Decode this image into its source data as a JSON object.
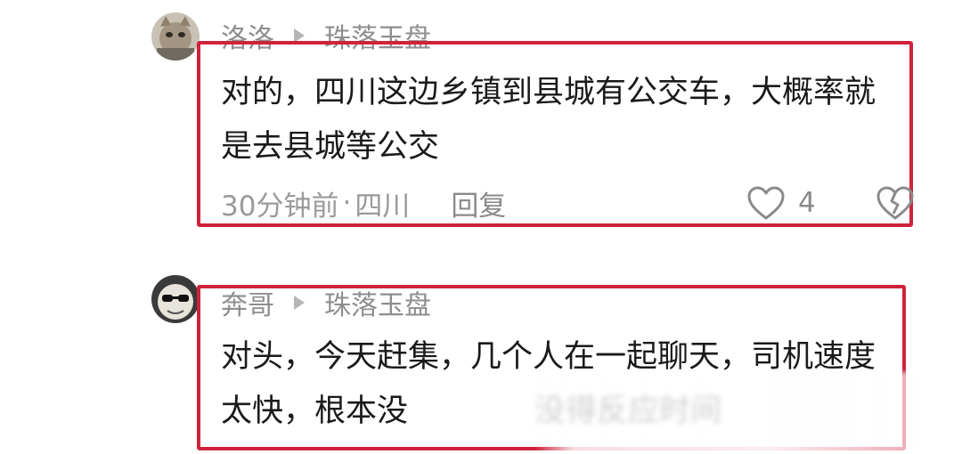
{
  "comments": [
    {
      "username": "洛洛",
      "reply_to": "珠落玉盘",
      "text": "对的，四川这边乡镇到县城有公交车，大概率就是去县城等公交",
      "timestamp": "30分钟前",
      "location": "四川",
      "reply_label": "回复",
      "like_count": "4"
    },
    {
      "username": "奔哥",
      "reply_to": "珠落玉盘",
      "text": "对头，今天赶集，几个人在一起聊天，司机速度太快，根本没",
      "blurred_text": "没得反应时间"
    }
  ],
  "colors": {
    "highlight_border": "#d0223a",
    "meta_text": "#8e8e8e"
  }
}
